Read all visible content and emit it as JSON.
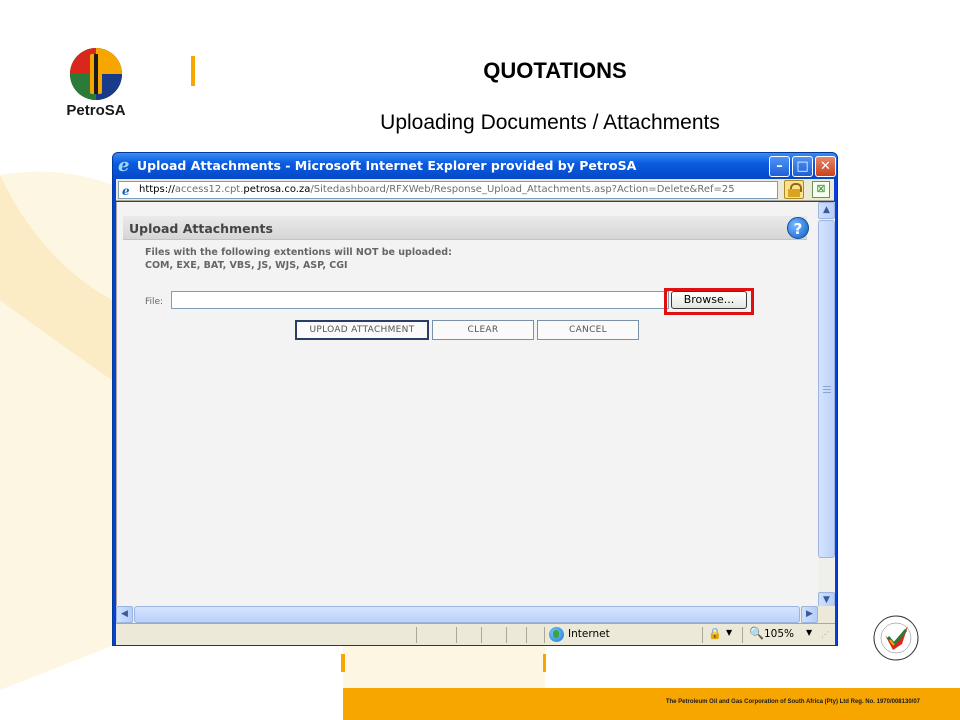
{
  "slide": {
    "title": "QUOTATIONS",
    "subtitle": "Uploading  Documents / Attachments",
    "logo_text": "PetroSA",
    "footer": "The Petroleum Oil and Gas Corporation of South Africa (Pty) Ltd  Reg. No. 1970/008130/07",
    "badge_text": "PROUDLY SOUTH AFRICAN"
  },
  "colors": {
    "accent": "#f7a600",
    "highlight": "#e01010",
    "titlebar": "#0a5be0"
  },
  "window": {
    "title": "Upload Attachments - Microsoft Internet Explorer provided by PetroSA",
    "min_glyph": "–",
    "max_glyph": "□",
    "close_glyph": "✕",
    "address": {
      "scheme": "https://",
      "pre_domain": "access12.cpt.",
      "domain": "petrosa.co.za",
      "path": "/Sitedashboard/RFXWeb/Response_Upload_Attachments.asp?Action=Delete&Ref=25"
    },
    "status": {
      "zone": "Internet",
      "zoom": "105%"
    }
  },
  "form": {
    "header": "Upload Attachments",
    "help_glyph": "?",
    "warning_line1": "Files with the following extentions will NOT be uploaded:",
    "warning_line2": "COM, EXE, BAT, VBS, JS, WJS, ASP, CGI",
    "file_label": "File:",
    "file_value": "",
    "browse_label": "Browse...",
    "buttons": {
      "upload": "UPLOAD ATTACHMENT",
      "clear": "CLEAR",
      "cancel": "CANCEL"
    }
  }
}
